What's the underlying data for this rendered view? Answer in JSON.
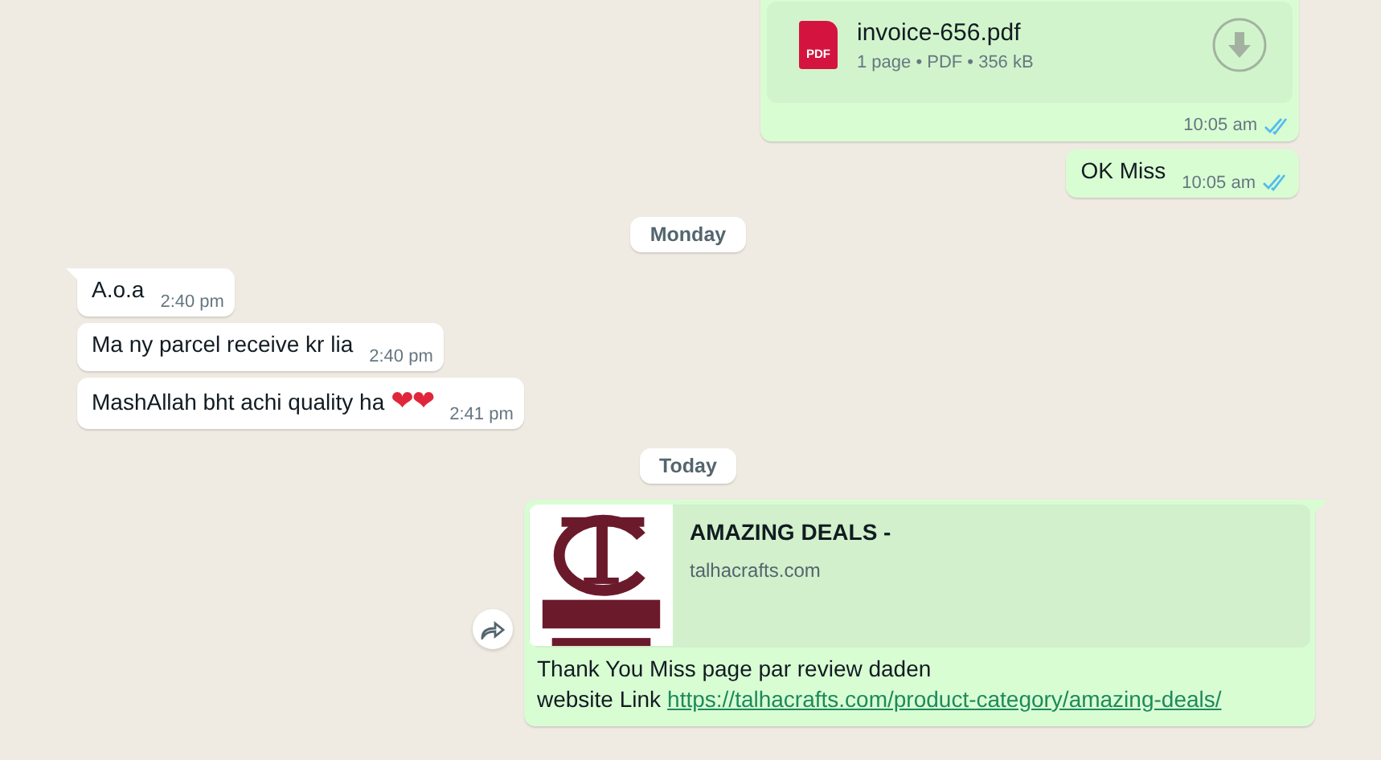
{
  "messages": [
    {
      "kind": "document",
      "outgoing": true,
      "file_name": "invoice-656.pdf",
      "icon_label": "PDF",
      "meta": "1 page • PDF • 356 kB",
      "time": "10:05 am",
      "read": true
    },
    {
      "kind": "text",
      "outgoing": true,
      "text": "OK Miss",
      "time": "10:05 am",
      "read": true
    },
    {
      "kind": "date",
      "text": "Monday"
    },
    {
      "kind": "text",
      "outgoing": false,
      "tail": true,
      "text": "A.o.a",
      "time": "2:40 pm"
    },
    {
      "kind": "text",
      "outgoing": false,
      "tail": false,
      "text": "Ma ny parcel receive kr lia",
      "time": "2:40 pm"
    },
    {
      "kind": "text",
      "outgoing": false,
      "tail": false,
      "text": "MashAllah bht achi quality ha",
      "emoji": "❤❤",
      "time": "2:41 pm"
    },
    {
      "kind": "date",
      "text": "Today"
    },
    {
      "kind": "link",
      "outgoing": true,
      "tail": true,
      "forward_button": true,
      "preview_title": "AMAZING DEALS -",
      "preview_domain": "talhacrafts.com",
      "text": "Thank You Miss page par review daden",
      "link_label": "website Link",
      "url": "https://talhacrafts.com/product-category/amazing-deals/"
    }
  ]
}
